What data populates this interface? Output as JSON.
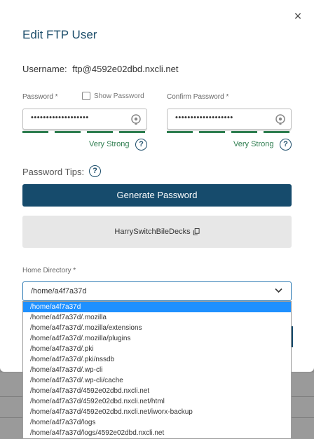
{
  "modal": {
    "title": "Edit FTP User",
    "close_label": "×",
    "username_label": "Username:",
    "username_value": "ftp@4592e02dbd.nxcli.net"
  },
  "password": {
    "label": "Password *",
    "show_label": "Show Password",
    "value_masked": "•••••••••••••••••••",
    "strength": "Very Strong",
    "strength_color": "#2e7d4f"
  },
  "confirm": {
    "label": "Confirm Password *",
    "value_masked": "•••••••••••••••••••",
    "strength": "Very Strong"
  },
  "tips": {
    "label": "Password Tips:",
    "help": "?"
  },
  "generate": {
    "button_label": "Generate Password",
    "generated_value": "HarrySwitchBileDecks",
    "accent": "#164b6c"
  },
  "home_directory": {
    "label": "Home Directory *",
    "selected": "/home/a4f7a37d",
    "options": [
      "/home/a4f7a37d",
      "/home/a4f7a37d/.mozilla",
      "/home/a4f7a37d/.mozilla/extensions",
      "/home/a4f7a37d/.mozilla/plugins",
      "/home/a4f7a37d/.pki",
      "/home/a4f7a37d/.pki/nssdb",
      "/home/a4f7a37d/.wp-cli",
      "/home/a4f7a37d/.wp-cli/cache",
      "/home/a4f7a37d/4592e02dbd.nxcli.net",
      "/home/a4f7a37d/4592e02dbd.nxcli.net/html",
      "/home/a4f7a37d/4592e02dbd.nxcli.net/iworx-backup",
      "/home/a4f7a37d/logs",
      "/home/a4f7a37d/logs/4592e02dbd.nxcli.net"
    ]
  },
  "icons": {
    "close": "close-icon",
    "eye": "eye-icon",
    "help": "help-icon",
    "copy": "copy-icon",
    "chevron": "chevron-down-icon"
  }
}
